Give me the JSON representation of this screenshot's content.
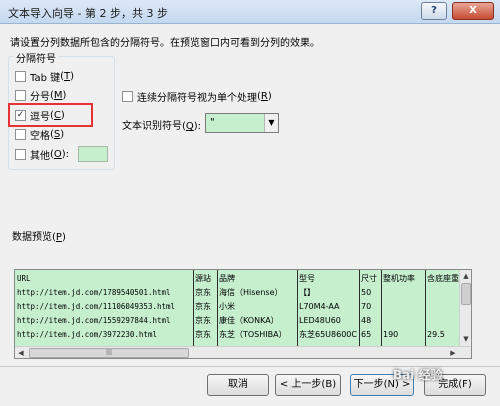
{
  "window": {
    "title": "文本导入向导 - 第 2 步，共 3 步",
    "help_glyph": "?",
    "close_glyph": "X"
  },
  "instruction": "请设置分列数据所包含的分隔符号。在预览窗口内可看到分列的效果。",
  "delimiters": {
    "group_title": "分隔符号",
    "items": [
      {
        "label": "Tab 键",
        "hotkey": "T",
        "checked": false
      },
      {
        "label": "分号",
        "hotkey": "M",
        "checked": false
      },
      {
        "label": "逗号",
        "hotkey": "C",
        "checked": true
      },
      {
        "label": "空格",
        "hotkey": "S",
        "checked": false
      },
      {
        "label": "其他",
        "hotkey": "O",
        "checked": false
      }
    ],
    "highlight_color": "#e53233",
    "other_color": "#c6efce"
  },
  "consecutive": {
    "label": "连续分隔符号视为单个处理",
    "hotkey": "R",
    "checked": false
  },
  "text_qualifier": {
    "label": "文本识别符号",
    "hotkey": "Q",
    "value": "\""
  },
  "preview": {
    "label": "数据预览",
    "hotkey": "P",
    "rows": [
      [
        "URL",
        "源站",
        "品牌",
        "型号",
        "尺寸",
        "整机功率",
        "含底座重"
      ],
      [
        "http://item.jd.com/1789540501.html",
        "京东",
        "海信（Hisense）",
        "【】",
        "50",
        "",
        ""
      ],
      [
        "http://item.jd.com/11106049353.html",
        "京东",
        "小米",
        "L70M4-AA",
        "70",
        "",
        ""
      ],
      [
        "http://item.jd.com/1559297844.html",
        "京东",
        "康佳（KONKA）",
        "LED48U60",
        "48",
        "",
        ""
      ],
      [
        "http://item.jd.com/3972230.html",
        "京东",
        "东芝（TOSHIBA）",
        "东芝65U8600C",
        "65",
        "190",
        "29.5"
      ]
    ],
    "bg_color": "#c6efce"
  },
  "buttons": {
    "cancel": "取消",
    "back": "< 上一步(B)",
    "next": "下一步(N) >",
    "finish": "完成(F)"
  },
  "watermark": "Bai 经验"
}
